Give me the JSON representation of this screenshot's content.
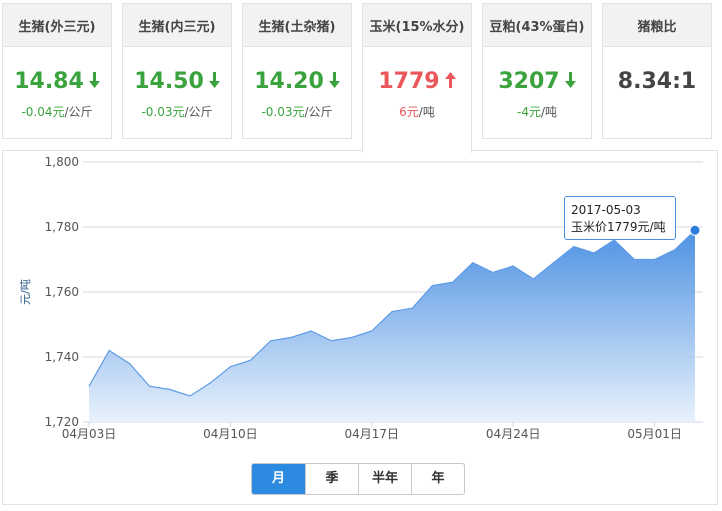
{
  "cards": [
    {
      "title": "生猪(外三元)",
      "price": "14.84",
      "direction": "down",
      "change": "-0.04元",
      "unit": "/公斤"
    },
    {
      "title": "生猪(内三元)",
      "price": "14.50",
      "direction": "down",
      "change": "-0.03元",
      "unit": "/公斤"
    },
    {
      "title": "生猪(土杂猪)",
      "price": "14.20",
      "direction": "down",
      "change": "-0.03元",
      "unit": "/公斤"
    },
    {
      "title": "玉米(15%水分)",
      "price": "1779",
      "direction": "up",
      "change": "6元",
      "unit": "/吨"
    },
    {
      "title": "豆粕(43%蛋白)",
      "price": "3207",
      "direction": "down",
      "change": "-4元",
      "unit": "/吨"
    },
    {
      "title": "猪粮比",
      "price": "8.34:1",
      "direction": "flat",
      "change": "",
      "unit": ""
    }
  ],
  "active_card": 3,
  "colors": {
    "up": "#e9575a",
    "down": "#3aa33d",
    "accent": "#2c8be0",
    "area_top": "#3b86e0",
    "area_bottom": "#e6f0fb"
  },
  "tooltip": {
    "date": "2017-05-03",
    "text": "玉米价1779元/吨"
  },
  "range_tabs": [
    {
      "label": "月",
      "active": true
    },
    {
      "label": "季",
      "active": false
    },
    {
      "label": "半年",
      "active": false
    },
    {
      "label": "年",
      "active": false
    }
  ],
  "chart_data": {
    "type": "area",
    "ylabel": "元/吨",
    "ylim": [
      1720,
      1800
    ],
    "yticks": [
      1720,
      1740,
      1760,
      1780,
      1800
    ],
    "ytick_labels": [
      "1,720",
      "1,740",
      "1,760",
      "1,780",
      "1,800"
    ],
    "x": [
      "04-03",
      "04-04",
      "04-05",
      "04-06",
      "04-07",
      "04-08",
      "04-09",
      "04-10",
      "04-11",
      "04-12",
      "04-13",
      "04-14",
      "04-15",
      "04-16",
      "04-17",
      "04-18",
      "04-19",
      "04-20",
      "04-21",
      "04-22",
      "04-23",
      "04-24",
      "04-25",
      "04-26",
      "04-27",
      "04-28",
      "04-29",
      "04-30",
      "05-01",
      "05-02",
      "05-03"
    ],
    "xticks": [
      {
        "index": 0,
        "label": "04月03日"
      },
      {
        "index": 7,
        "label": "04月10日"
      },
      {
        "index": 14,
        "label": "04月17日"
      },
      {
        "index": 21,
        "label": "04月24日"
      },
      {
        "index": 28,
        "label": "05月01日"
      }
    ],
    "series": [
      {
        "values": [
          1731,
          1742,
          1738,
          1731,
          1730,
          1728,
          1732,
          1737,
          1739,
          1745,
          1746,
          1748,
          1745,
          1746,
          1748,
          1754,
          1755,
          1762,
          1763,
          1769,
          1766,
          1768,
          1764,
          1769,
          1774,
          1772,
          1776,
          1770,
          1770,
          1773,
          1779
        ]
      }
    ],
    "highlight_index": 30,
    "grid": true
  }
}
